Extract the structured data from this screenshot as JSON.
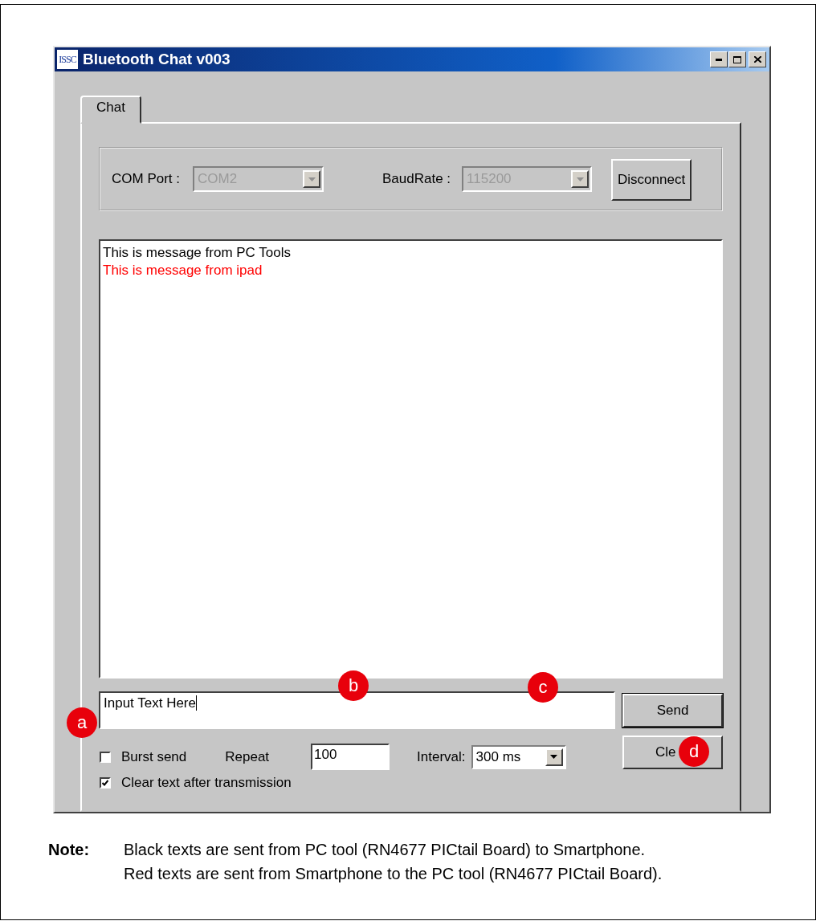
{
  "window": {
    "logo": "ISSC",
    "title": "Bluetooth Chat v003"
  },
  "tabs": [
    {
      "label": "Chat",
      "selected": true
    }
  ],
  "connection": {
    "fields": [
      {
        "label": "COM Port :",
        "value": "COM2",
        "disabled": true
      },
      {
        "label": "BaudRate :",
        "value": "115200",
        "disabled": true
      }
    ],
    "button": "Disconnect"
  },
  "messages": [
    {
      "text": "This is message from PC Tools",
      "color": "#000000"
    },
    {
      "text": "This is message from ipad",
      "color": "#ff0000"
    }
  ],
  "input": {
    "value": "Input Text Here"
  },
  "buttons": [
    "Send",
    "Cle"
  ],
  "options": {
    "burst_send": {
      "label": "Burst send",
      "checked": false
    },
    "repeat": {
      "label": "Repeat",
      "value": "100"
    },
    "interval": {
      "label": "Interval:",
      "value": "300 ms"
    },
    "clear_text": {
      "label": "Clear text after transmission",
      "checked": true
    }
  },
  "callouts": [
    "a",
    "b",
    "c",
    "d"
  ],
  "note": {
    "label": "Note:",
    "lines": [
      "Black texts are sent from PC tool (RN4677 PICtail Board) to Smartphone.",
      "Red texts are sent from Smartphone to the PC tool (RN4677 PICtail Board)."
    ]
  }
}
